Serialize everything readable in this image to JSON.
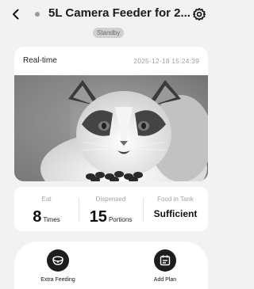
{
  "header": {
    "title": "5L Camera Feeder for 2...",
    "status_badge": "Standby"
  },
  "live": {
    "label": "Real-time",
    "timestamp": "2025-12-18  15:24:39"
  },
  "stats": [
    {
      "label": "Eat",
      "value": "8",
      "unit": "Times"
    },
    {
      "label": "Dispensed",
      "value": "15",
      "unit": "Portions"
    },
    {
      "label": "Food in Tank",
      "value": "Sufficient"
    }
  ],
  "actions": {
    "extra_feeding": "Extra Feeding",
    "add_plan": "Add Plan"
  },
  "icons": {
    "back": "chevron-left-icon",
    "status": "status-dot-icon",
    "settings": "gear-icon",
    "extra_feeding": "food-bowl-icon",
    "add_plan": "calendar-plan-icon"
  }
}
